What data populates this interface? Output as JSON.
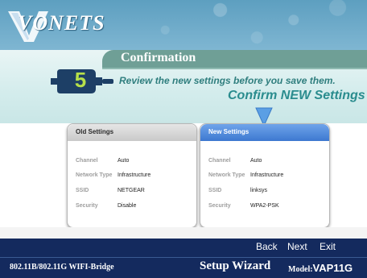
{
  "brand": {
    "logo_text": "VONETS"
  },
  "page": {
    "title": "Confirmation",
    "step_number": "5",
    "instruction": "Review the new settings before you save them.",
    "confirm_heading": "Confirm NEW Settings"
  },
  "old_settings": {
    "title": "Old Settings",
    "rows": [
      {
        "label": "Channel",
        "value": "Auto"
      },
      {
        "label": "Network Type",
        "value": "Infrastructure"
      },
      {
        "label": "SSID",
        "value": "NETGEAR"
      },
      {
        "label": "Security",
        "value": "Disable"
      }
    ]
  },
  "new_settings": {
    "title": "New Settings",
    "rows": [
      {
        "label": "Channel",
        "value": "Auto"
      },
      {
        "label": "Network Type",
        "value": "Infrastructure"
      },
      {
        "label": "SSID",
        "value": "linksys"
      },
      {
        "label": "Security",
        "value": "WPA2-PSK"
      }
    ]
  },
  "nav": {
    "back": "Back",
    "next": "Next",
    "exit": "Exit"
  },
  "footer": {
    "product": "802.11B/802.11G  WIFI-Bridge",
    "wizard": "Setup Wizard",
    "model_label": "Model:",
    "model_name": "VAP11G"
  },
  "colors": {
    "header": "#5d9fc0",
    "title_tab": "#6f9f96",
    "instruction": "#2f7e7e",
    "new_panel_head": "#3d78d0",
    "navbar": "#142a5e",
    "step_badge": "#1d3f66",
    "step_number": "#b6e04a"
  },
  "icons": {
    "step": "usb-plug-icon",
    "arrow": "down-arrow-icon",
    "logo": "vonets-logo"
  }
}
